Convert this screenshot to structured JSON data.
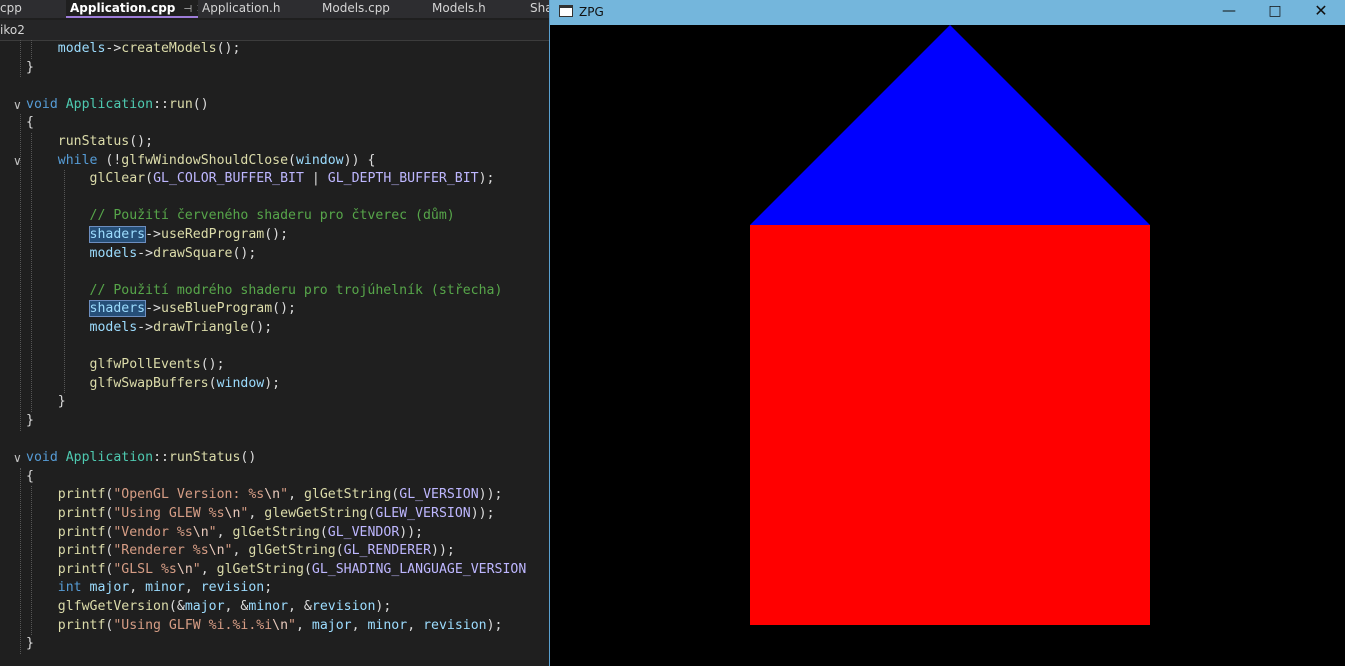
{
  "ide": {
    "tabs": [
      {
        "label": "cpp",
        "active": false
      },
      {
        "label": "Application.cpp",
        "active": true,
        "pin_icon": "pin-icon",
        "close_icon": "close-icon"
      },
      {
        "label": "Application.h",
        "active": false
      },
      {
        "label": "Models.cpp",
        "active": false
      },
      {
        "label": "Models.h",
        "active": false
      },
      {
        "label": "Sha",
        "active": false
      }
    ],
    "nav_scope": "iko2",
    "code_lines": [
      "    models->createModels();",
      "}",
      "",
      "void Application::run()",
      "{",
      "    runStatus();",
      "    while (!glfwWindowShouldClose(window)) {",
      "        glClear(GL_COLOR_BUFFER_BIT | GL_DEPTH_BUFFER_BIT);",
      "",
      "        // Použití červeného shaderu pro čtverec (dům)",
      "        shaders->useRedProgram();",
      "        models->drawSquare();",
      "",
      "        // Použití modrého shaderu pro trojúhelník (střecha)",
      "        shaders->useBlueProgram();",
      "        models->drawTriangle();",
      "",
      "        glfwPollEvents();",
      "        glfwSwapBuffers(window);",
      "    }",
      "}",
      "",
      "void Application::runStatus()",
      "{",
      "    printf(\"OpenGL Version: %s\\n\", glGetString(GL_VERSION));",
      "    printf(\"Using GLEW %s\\n\", glewGetString(GLEW_VERSION));",
      "    printf(\"Vendor %s\\n\", glGetString(GL_VENDOR));",
      "    printf(\"Renderer %s\\n\", glGetString(GL_RENDERER));",
      "    printf(\"GLSL %s\\n\", glGetString(GL_SHADING_LANGUAGE_VERSION",
      "    int major, minor, revision;",
      "    glfwGetVersion(&major, &minor, &revision);",
      "    printf(\"Using GLFW %i.%i.%i\\n\", major, minor, revision);",
      "}"
    ],
    "fold_icon": "chevron-down-icon",
    "colors": {
      "keyword": "#569cd6",
      "class": "#4ec9b0",
      "function": "#dcdcaa",
      "variable": "#9cdcfe",
      "macro": "#beb7ff",
      "string": "#d69d85",
      "comment": "#57a64a",
      "selection": "#264f78"
    }
  },
  "window": {
    "title": "ZPG",
    "icon": "app-window-icon",
    "buttons": [
      "minimize-icon",
      "maximize-icon",
      "close-icon"
    ],
    "background_color": "#000000",
    "scene": {
      "roof_color": "#0000ff",
      "wall_color": "#ff0000"
    }
  }
}
